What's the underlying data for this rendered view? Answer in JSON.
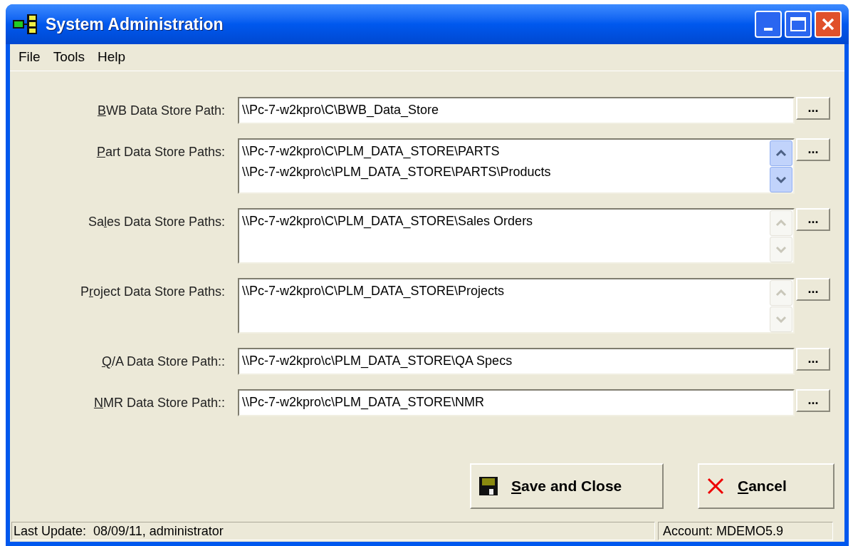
{
  "window": {
    "title": "System Administration"
  },
  "menu": [
    {
      "label": "File"
    },
    {
      "label": "Tools"
    },
    {
      "label": "Help"
    }
  ],
  "fields": [
    {
      "kind": "single",
      "access_key": "B",
      "label_after": "WB Data Store Path:",
      "lines": [
        "\\\\Pc-7-w2kpro\\C\\BWB_Data_Store"
      ],
      "browse": "..."
    },
    {
      "kind": "multi",
      "access_key": "P",
      "label_after": "art Data Store Paths:",
      "lines": [
        "\\\\Pc-7-w2kpro\\C\\PLM_DATA_STORE\\PARTS",
        "\\\\Pc-7-w2kpro\\c\\PLM_DATA_STORE\\PARTS\\Products"
      ],
      "scroll_enabled": true,
      "browse": "..."
    },
    {
      "kind": "multi",
      "label_before": "Sa",
      "access_key": "l",
      "label_after": "es Data Store Paths:",
      "lines": [
        "\\\\Pc-7-w2kpro\\C\\PLM_DATA_STORE\\Sales Orders"
      ],
      "scroll_enabled": false,
      "browse": "..."
    },
    {
      "kind": "multi",
      "label_before": "P",
      "access_key": "r",
      "label_after": "oject Data Store Paths:",
      "lines": [
        "\\\\Pc-7-w2kpro\\C\\PLM_DATA_STORE\\Projects"
      ],
      "scroll_enabled": false,
      "browse": "..."
    },
    {
      "kind": "single",
      "access_key": "Q",
      "label_after": "/A Data Store Path::",
      "lines": [
        "\\\\Pc-7-w2kpro\\c\\PLM_DATA_STORE\\QA Specs"
      ],
      "browse": "..."
    },
    {
      "kind": "single",
      "access_key": "N",
      "label_after": "MR Data Store Path::",
      "lines": [
        "\\\\Pc-7-w2kpro\\c\\PLM_DATA_STORE\\NMR"
      ],
      "browse": "..."
    }
  ],
  "buttons": [
    {
      "kind": "save",
      "access_key": "S",
      "label_after": "ave and Close"
    },
    {
      "kind": "cancel",
      "access_key": "C",
      "label_after": "ancel"
    }
  ],
  "status_bar": {
    "left": "Last Update:  08/09/11, administrator",
    "right": "Account: MDEMO5.9"
  }
}
